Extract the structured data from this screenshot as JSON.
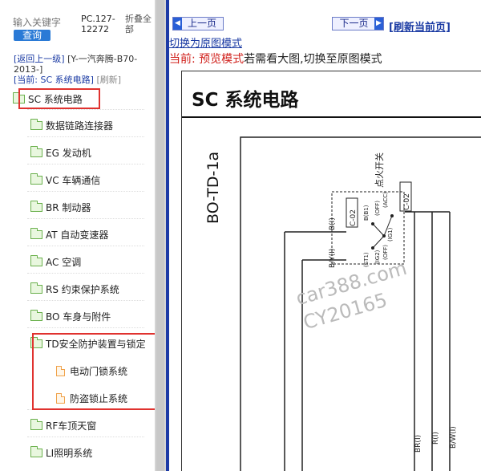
{
  "search": {
    "placeholder": "输入关键字",
    "button_label": "查询"
  },
  "catalog": {
    "code": "PC.127-12272",
    "collapse_all": "折叠全部"
  },
  "nav": {
    "back": "[返回上一级]",
    "car": "[Y-一汽奔腾-B70-2013-]",
    "current": "[当前: SC 系统电路]",
    "refresh": "[刷新]"
  },
  "tree": [
    {
      "label": "SC 系统电路",
      "type": "folder",
      "open": true
    },
    {
      "label": "数据链路连接器",
      "type": "folder"
    },
    {
      "label": "EG 发动机",
      "type": "folder"
    },
    {
      "label": "VC 车辆通信",
      "type": "folder"
    },
    {
      "label": "BR 制动器",
      "type": "folder"
    },
    {
      "label": "AT 自动变速器",
      "type": "folder"
    },
    {
      "label": "AC 空调",
      "type": "folder"
    },
    {
      "label": "RS 约束保护系统",
      "type": "folder"
    },
    {
      "label": "BO 车身与附件",
      "type": "folder"
    },
    {
      "label": "TD安全防护装置与锁定",
      "type": "folder",
      "open": true
    },
    {
      "label": "电动门锁系统",
      "type": "page"
    },
    {
      "label": "防盗锁止系统",
      "type": "page"
    },
    {
      "label": "RF车顶天窗",
      "type": "folder"
    },
    {
      "label": "LI照明系统",
      "type": "folder"
    }
  ],
  "viewer": {
    "prev_label": "上一页",
    "next_label": "下一页",
    "refresh_label": "[刷新当前页]",
    "switch_label": "切换为原图模式",
    "mode_prefix": "当前: ",
    "mode_name": "预览模式",
    "mode_suffix": "若需看大图,切换至原图模式"
  },
  "diagram": {
    "title": "SC 系统电路",
    "side_code": "BO-TD-1a",
    "ignition_label": "点火开关",
    "connector_left": "C-02",
    "connector_right": "C-02",
    "pin_b": "B(I)",
    "pin_by": "B/Y(I)",
    "pin_labels": [
      "BR(I)",
      "R(I)",
      "B/W(I)"
    ],
    "switch_labels": [
      "B(B1)",
      "(OFF)",
      "(ACC)",
      "(IG1)",
      "(ST1)",
      "(IG2)",
      "(OFF)"
    ],
    "watermark_1": "car388.com",
    "watermark_2": "CY20165"
  },
  "colors": {
    "accent_blue": "#1c3aa6",
    "highlight_red": "#e0322f",
    "mode_red": "#d0201b",
    "folder_green": "#6ab04c",
    "page_orange": "#f0a24a"
  }
}
